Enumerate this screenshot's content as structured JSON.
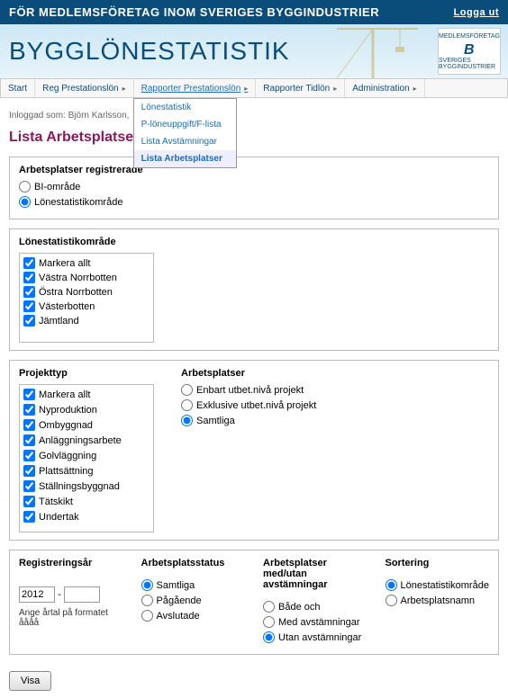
{
  "header": {
    "tagline": "FÖR MEDLEMSFÖRETAG INOM SVERIGES BYGGINDUSTRIER",
    "logout": "Logga ut",
    "brand": "BYGGLÖNESTATISTIK",
    "logo_text_top": "MEDLEMSFÖRETAG",
    "logo_text_bottom": "SVERIGES BYGGINDUSTRIER"
  },
  "menu": {
    "items": [
      {
        "label": "Start",
        "has_arrow": false
      },
      {
        "label": "Reg Prestationslön",
        "has_arrow": true
      },
      {
        "label": "Rapporter Prestationslön",
        "has_arrow": true,
        "active": true
      },
      {
        "label": "Rapporter Tidlön",
        "has_arrow": true
      },
      {
        "label": "Administration",
        "has_arrow": true
      }
    ],
    "dropdown": [
      "Lönestatistik",
      "P-löneuppgift/F-lista",
      "Lista Avstämningar",
      "Lista Arbetsplatser"
    ],
    "dropdown_selected": "Lista Arbetsplatser"
  },
  "logged_in_prefix": "Inloggad som: ",
  "logged_in_user": "Björn Karlsson,",
  "page_title": "Lista Arbetsplatser",
  "panel1": {
    "title": "Arbetsplatser registrerade",
    "options": [
      "BI-område",
      "Lönestatistikområde"
    ],
    "selected": "Lönestatistikområde"
  },
  "panel2": {
    "title": "Lönestatistikområde",
    "items": [
      {
        "label": "Markera allt",
        "checked": true
      },
      {
        "label": "Västra Norrbotten",
        "checked": true
      },
      {
        "label": "Östra Norrbotten",
        "checked": true
      },
      {
        "label": "Västerbotten",
        "checked": true
      },
      {
        "label": "Jämtland",
        "checked": true
      }
    ]
  },
  "panel3": {
    "col1_title": "Projekttyp",
    "col1_items": [
      {
        "label": "Markera allt",
        "checked": true
      },
      {
        "label": "Nyproduktion",
        "checked": true
      },
      {
        "label": "Ombyggnad",
        "checked": true
      },
      {
        "label": "Anläggningsarbete",
        "checked": true
      },
      {
        "label": "Golvläggning",
        "checked": true
      },
      {
        "label": "Plattsättning",
        "checked": true
      },
      {
        "label": "Ställningsbyggnad",
        "checked": true
      },
      {
        "label": "Tätskikt",
        "checked": true
      },
      {
        "label": "Undertak",
        "checked": true
      }
    ],
    "col2_title": "Arbetsplatser",
    "col2_options": [
      "Enbart utbet.nivå projekt",
      "Exklusive utbet.nivå projekt",
      "Samtliga"
    ],
    "col2_selected": "Samtliga"
  },
  "panel4": {
    "col1_title": "Registreringsår",
    "year_from": "2012",
    "year_sep": "-",
    "year_to": "",
    "year_hint": "Ange årtal på formatet åååå",
    "col2_title": "Arbetsplatsstatus",
    "col2_options": [
      "Samtliga",
      "Pågående",
      "Avslutade"
    ],
    "col2_selected": "Samtliga",
    "col3_title": "Arbetsplatser med/utan avstämningar",
    "col3_options": [
      "Både och",
      "Med avstämningar",
      "Utan avstämningar"
    ],
    "col3_selected": "Utan avstämningar",
    "col4_title": "Sortering",
    "col4_options": [
      "Lönestatistikområde",
      "Arbetsplatsnamn"
    ],
    "col4_selected": "Lönestatistikområde"
  },
  "visa_button": "Visa"
}
